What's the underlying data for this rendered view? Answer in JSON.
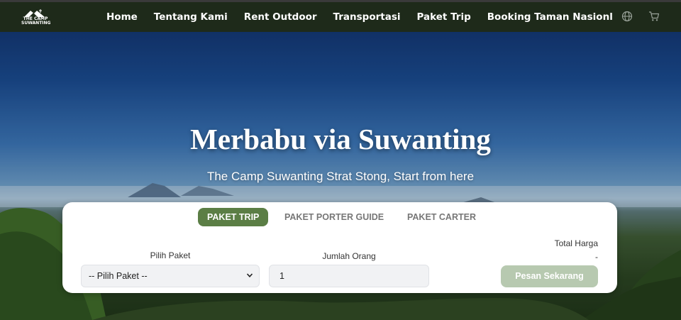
{
  "brand": {
    "logo_text_line1": "THE CAMP",
    "logo_text_line2": "SUWANTING"
  },
  "nav": {
    "items": [
      {
        "label": "Home"
      },
      {
        "label": "Tentang Kami"
      },
      {
        "label": "Rent Outdoor"
      },
      {
        "label": "Transportasi"
      },
      {
        "label": "Paket Trip"
      },
      {
        "label": "Booking Taman Nasionl"
      }
    ],
    "icons": [
      "globe-icon",
      "cart-icon"
    ]
  },
  "hero": {
    "title": "Merbabu via Suwanting",
    "subtitle": "The Camp Suwanting Strat Stong, Start from here"
  },
  "booking": {
    "tabs": [
      {
        "label": "PAKET TRIP",
        "active": true
      },
      {
        "label": "PAKET PORTER GUIDE",
        "active": false
      },
      {
        "label": "PAKET CARTER",
        "active": false
      }
    ],
    "paket_label": "Pilih Paket",
    "paket_selected": "-- Pilih Paket --",
    "jumlah_label": "Jumlah Orang",
    "jumlah_value": "1",
    "total_label": "Total Harga",
    "total_value": "-",
    "order_button": "Pesan Sekarang"
  },
  "colors": {
    "navbar_bg": "#1e2a1a",
    "active_tab": "#5b7e45",
    "order_button": "#b7c9b0"
  }
}
